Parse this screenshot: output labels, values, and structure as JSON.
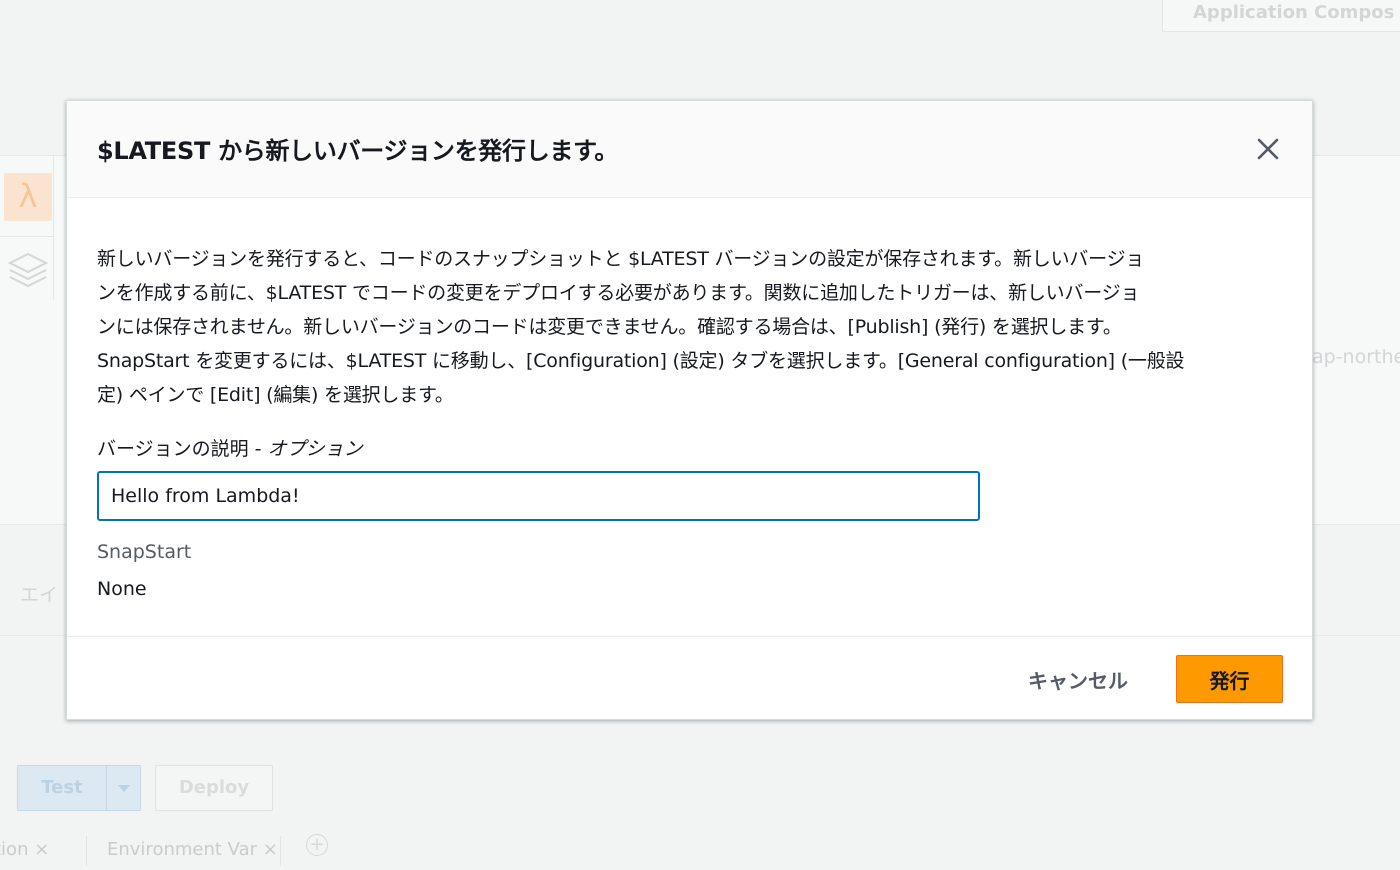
{
  "background": {
    "top_button_label": "Application Compos",
    "right_text": "ap-northe",
    "alias_label": "エイ",
    "test_button_label": "Test",
    "deploy_button_label": "Deploy",
    "tab_1": "tion ×",
    "tab_2": "Environment Var ×",
    "tab_add": "+"
  },
  "modal": {
    "title": "$LATEST から新しいバージョンを発行します。",
    "description_lines": [
      "新しいバージョンを発行すると、コードのスナップショットと $LATEST バージョンの設定が保存されます。新しいバージョ",
      "ンを作成する前に、$LATEST でコードの変更をデプロイする必要があります。関数に追加したトリガーは、新しいバージョ",
      "ンには保存されません。新しいバージョンのコードは変更できません。確認する場合は、[Publish] (発行) を選択します。",
      "SnapStart を変更するには、$LATEST に移動し、[Configuration] (設定) タブを選択します。[General configuration] (一般設",
      "定) ペインで [Edit] (編集) を選択します。"
    ],
    "version_description": {
      "label": "バージョンの説明",
      "label_separator": " - ",
      "optional": "オプション",
      "value": "Hello from Lambda!"
    },
    "snapstart": {
      "label": "SnapStart",
      "value": "None"
    },
    "footer": {
      "cancel_label": "キャンセル",
      "publish_label": "発行"
    }
  }
}
